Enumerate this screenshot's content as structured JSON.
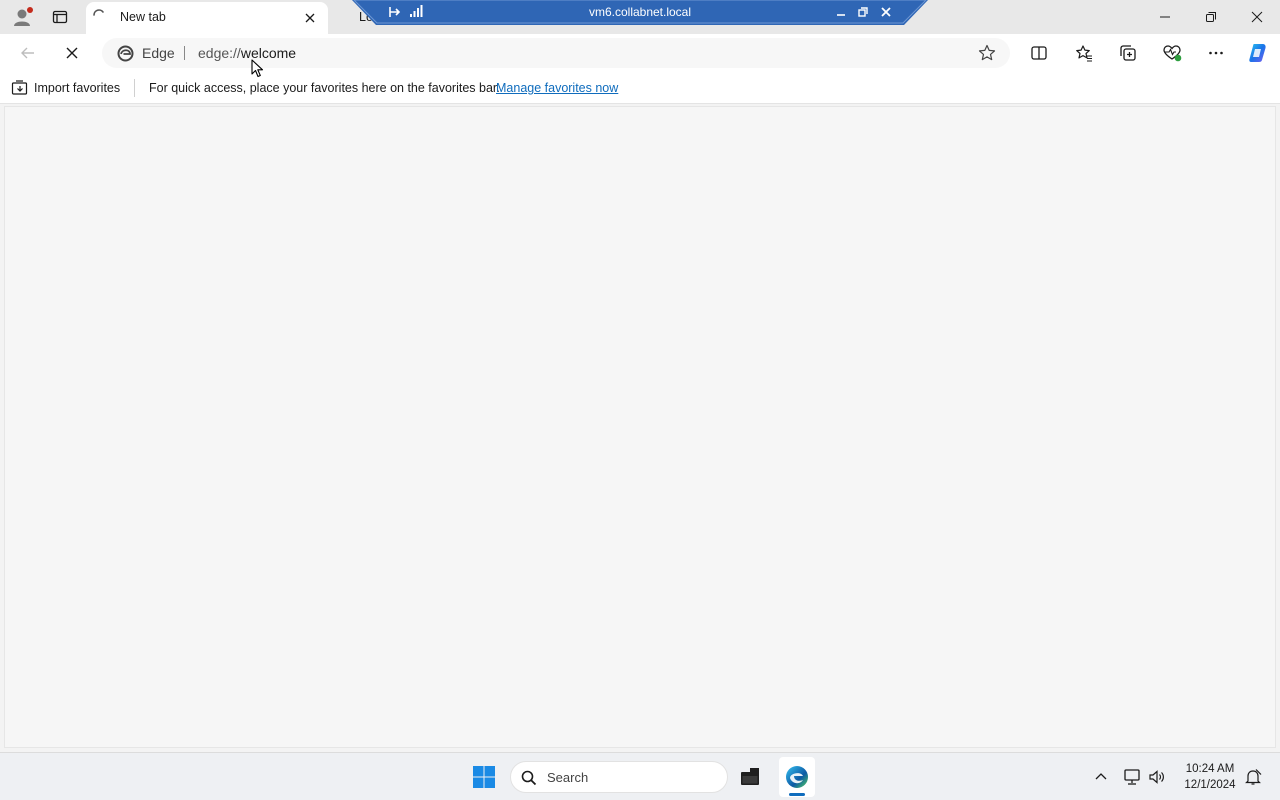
{
  "browser": {
    "tabs": [
      {
        "title": "New tab",
        "active": true,
        "loading": true
      },
      {
        "title": "Loa",
        "active": false
      }
    ],
    "rdp_bar": {
      "host": "vm6.collabnet.local"
    },
    "address_bar": {
      "site_label": "Edge",
      "url_prefix": "edge://",
      "url_path": "welcome"
    },
    "favorites_bar": {
      "import_label": "Import favorites",
      "hint": "For quick access, place your favorites here on the favorites bar.",
      "manage_link": "Manage favorites now"
    }
  },
  "taskbar": {
    "search_label": "Search",
    "clock": {
      "time": "10:24 AM",
      "date": "12/1/2024"
    }
  },
  "colors": {
    "accent": "#0f6cbd",
    "rdp_bar": "#2f66b5",
    "copilot": "#1a73e8"
  },
  "icons": [
    "profile-icon",
    "tab-actions-icon",
    "loading-spinner-icon",
    "close-icon",
    "back-icon",
    "stop-icon",
    "edge-logo-icon",
    "favorite-star-icon",
    "split-screen-icon",
    "favorites-icon",
    "collections-icon",
    "browser-essentials-icon",
    "more-icon",
    "copilot-icon",
    "import-favorites-icon",
    "windows-start-icon",
    "search-icon",
    "file-explorer-icon",
    "edge-taskbar-icon",
    "chevron-up-icon",
    "network-icon",
    "volume-icon",
    "notification-icon"
  ]
}
